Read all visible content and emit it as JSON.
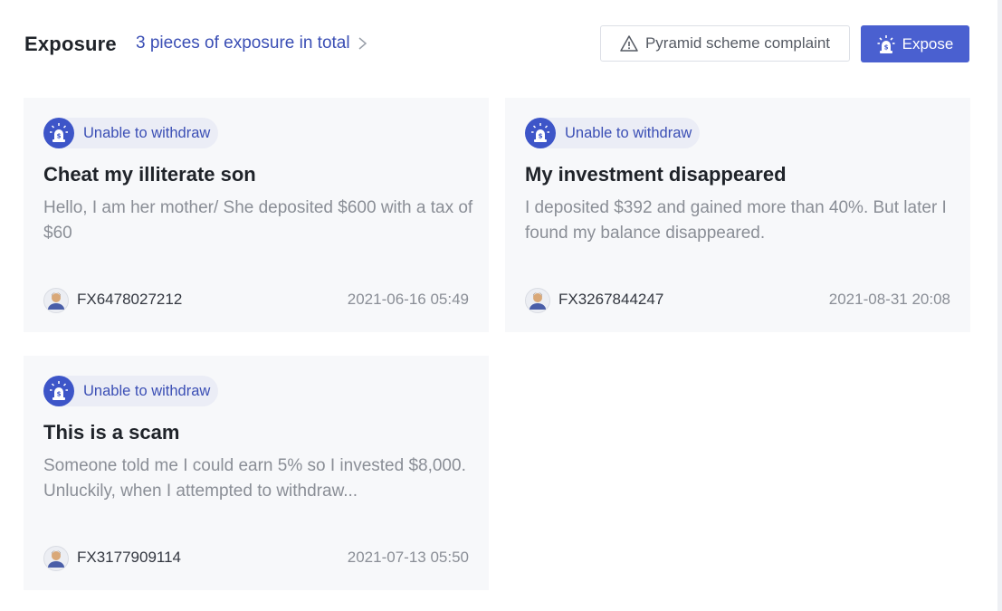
{
  "header": {
    "title": "Exposure",
    "summary": "3 pieces of exposure in total",
    "complaint_button": "Pyramid scheme complaint",
    "expose_button": "Expose"
  },
  "colors": {
    "accent": "#4a60d0",
    "link": "#3b4fb5",
    "card_bg": "#f7f8fa",
    "tag_bg": "#ebedf6"
  },
  "cards": [
    {
      "tag": "Unable to withdraw",
      "tag_icon": "siren-alarm-icon",
      "title": "Cheat my illiterate son",
      "body": "Hello, I am her mother/ She deposited $600 with a tax of $60",
      "user": "FX6478027212",
      "time": "2021-06-16 05:49"
    },
    {
      "tag": "Unable to withdraw",
      "tag_icon": "siren-alarm-icon",
      "title": "My investment disappeared",
      "body": "I deposited $392 and gained more than 40%. But later I found my balance disappeared.",
      "user": "FX3267844247",
      "time": "2021-08-31 20:08"
    },
    {
      "tag": "Unable to withdraw",
      "tag_icon": "siren-alarm-icon",
      "title": "This is a scam",
      "body": "Someone told me I could earn 5% so I invested $8,000. Unluckily, when I attempted to withdraw...",
      "user": "FX3177909114",
      "time": "2021-07-13 05:50"
    }
  ]
}
